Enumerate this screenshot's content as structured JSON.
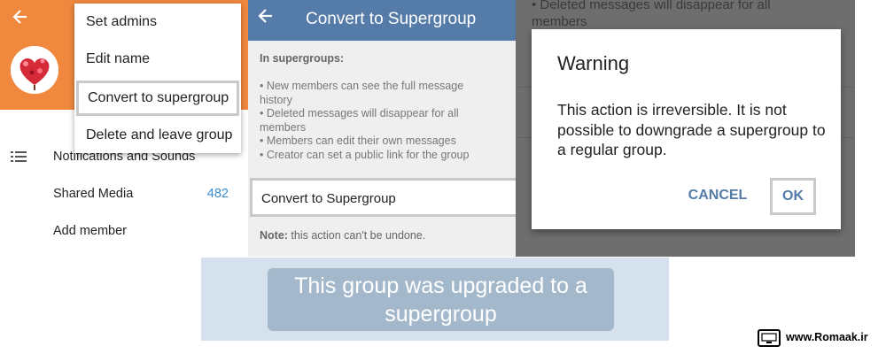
{
  "panel_group_info": {
    "menu": {
      "items": [
        "Set admins",
        "Edit name",
        "Convert to supergroup",
        "Delete and leave group"
      ],
      "highlighted_index": 2
    },
    "rows": {
      "notifications": "Notifications and Sounds",
      "shared_media": "Shared Media",
      "shared_media_count": "482",
      "add_member": "Add member"
    },
    "icons": {
      "back": "back-arrow-icon",
      "list": "list-icon"
    },
    "colors": {
      "header": "#f0883e",
      "count": "#3a8dd0"
    }
  },
  "panel_convert": {
    "title": "Convert to Supergroup",
    "subtitle": "In supergroups:",
    "bullets": [
      "• New members can see the full message",
      "history",
      "• Deleted messages will disappear for all",
      "members",
      "• Members can edit their own messages",
      "• Creator can set a public link for the group"
    ],
    "button_label": "Convert to Supergroup",
    "note_bold": "Note:",
    "note_text": " this action can't be undone.",
    "colors": {
      "header": "#557ba8"
    }
  },
  "panel_warning": {
    "background_text": [
      "• Deleted messages will disappear for all",
      "members"
    ],
    "dialog": {
      "title": "Warning",
      "message": "This action is irreversible. It is not possible to downgrade a supergroup to a regular group.",
      "cancel_label": "CANCEL",
      "ok_label": "OK"
    }
  },
  "banner": {
    "text": "This group was upgraded to a supergroup"
  },
  "watermark": {
    "text": "www.Romaak.ir"
  }
}
